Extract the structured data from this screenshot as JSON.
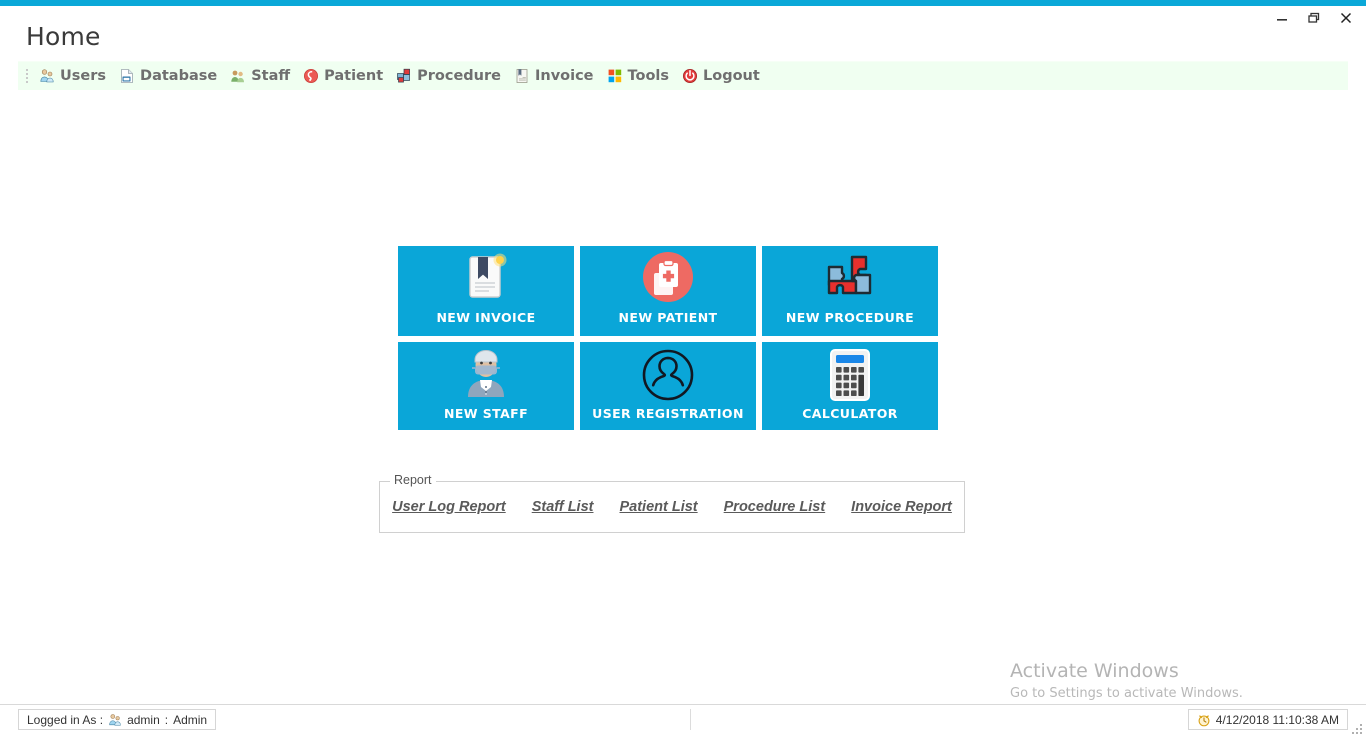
{
  "window": {
    "title": "Home",
    "controls": [
      {
        "name": "minimize",
        "label": "Minimize"
      },
      {
        "name": "restore",
        "label": "Restore"
      },
      {
        "name": "close",
        "label": "Close"
      }
    ],
    "accent_color": "#0ba8d8"
  },
  "menu": {
    "background": "#f0fff1",
    "items": [
      {
        "label": "Users",
        "icon": "users-icon"
      },
      {
        "label": "Database",
        "icon": "database-icon"
      },
      {
        "label": "Staff",
        "icon": "staff-icon"
      },
      {
        "label": "Patient",
        "icon": "patient-icon"
      },
      {
        "label": "Procedure",
        "icon": "procedure-icon"
      },
      {
        "label": "Invoice",
        "icon": "invoice-icon"
      },
      {
        "label": "Tools",
        "icon": "tools-icon"
      },
      {
        "label": "Logout",
        "icon": "logout-icon"
      }
    ]
  },
  "tiles": {
    "color": "#0aa6d8",
    "row1": [
      {
        "label": "NEW INVOICE",
        "icon": "invoice-bookmark-icon"
      },
      {
        "label": "NEW PATIENT",
        "icon": "patient-clipboard-icon"
      },
      {
        "label": "NEW PROCEDURE",
        "icon": "puzzle-icon"
      }
    ],
    "row2": [
      {
        "label": "NEW STAFF",
        "icon": "doctor-avatar-icon"
      },
      {
        "label": "USER REGISTRATION",
        "icon": "user-circle-icon"
      },
      {
        "label": "CALCULATOR",
        "icon": "calculator-icon"
      }
    ]
  },
  "report": {
    "legend": "Report",
    "links": [
      {
        "label": "User Log Report"
      },
      {
        "label": "Staff List"
      },
      {
        "label": "Patient List"
      },
      {
        "label": "Procedure List"
      },
      {
        "label": "Invoice Report"
      }
    ]
  },
  "watermark": {
    "title": "Activate Windows",
    "subtitle": "Go to Settings to activate Windows."
  },
  "statusbar": {
    "logged_in_label": "Logged in As :",
    "username": "admin",
    "separator": ":",
    "role": "Admin",
    "datetime": "4/12/2018 11:10:38 AM"
  }
}
